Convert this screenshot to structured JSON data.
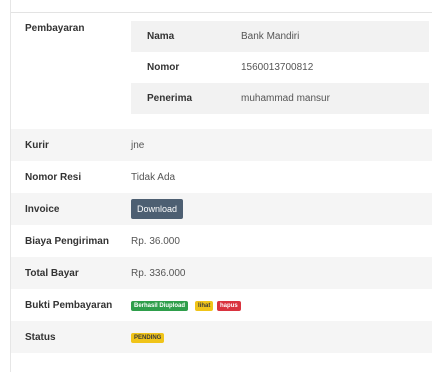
{
  "payment": {
    "label": "Pembayaran",
    "rows": [
      {
        "key": "Nama",
        "value": "Bank Mandiri"
      },
      {
        "key": "Nomor",
        "value": "1560013700812"
      },
      {
        "key": "Penerima",
        "value": "muhammad mansur"
      }
    ]
  },
  "courier": {
    "label": "Kurir",
    "value": "jne"
  },
  "receipt": {
    "label": "Nomor Resi",
    "value": "Tidak Ada"
  },
  "invoice": {
    "label": "Invoice",
    "button_label": "Download"
  },
  "shipping_cost": {
    "label": "Biaya Pengiriman",
    "value": "Rp. 36.000"
  },
  "total": {
    "label": "Total Bayar",
    "value": "Rp. 336.000"
  },
  "proof": {
    "label": "Bukti Pembayaran",
    "badges": {
      "uploaded": "Berhasil Diupload",
      "view": "lihat",
      "delete": "hapus"
    },
    "colors": {
      "uploaded": "#2e9e4b",
      "view": "#f0c419",
      "delete": "#d9333f"
    }
  },
  "status": {
    "label": "Status",
    "value": "PENDING",
    "color": "#f0c419"
  }
}
